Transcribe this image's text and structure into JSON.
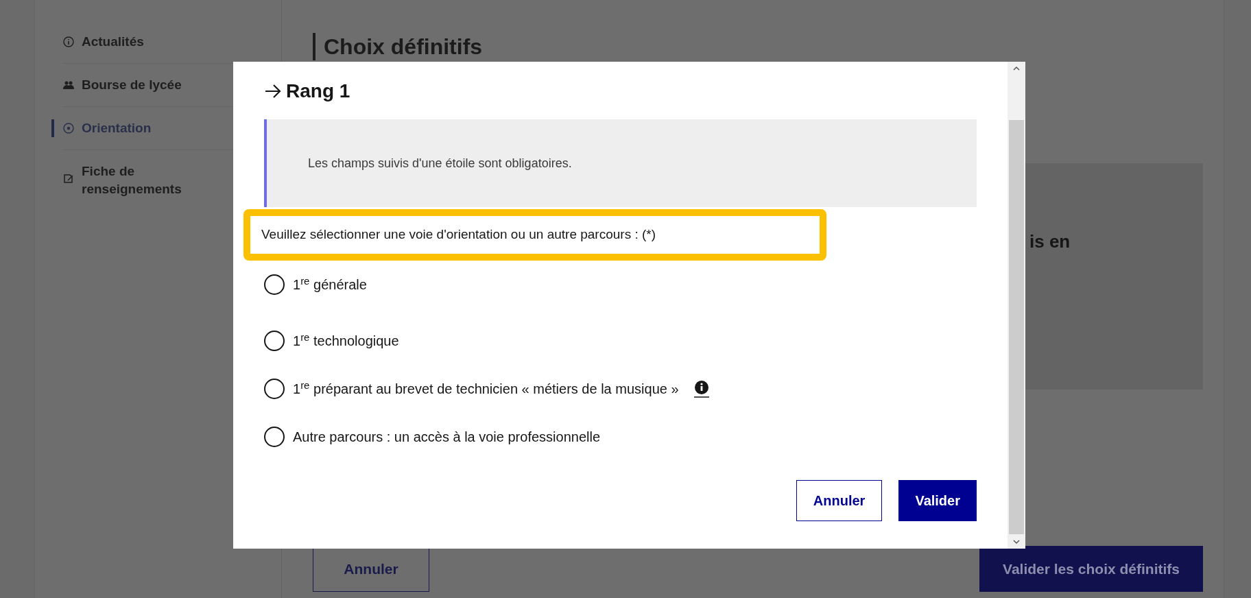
{
  "sidebar": {
    "items": [
      {
        "label": "Actualités",
        "selected": false
      },
      {
        "label": "Bourse de lycée",
        "selected": false
      },
      {
        "label": "Orientation",
        "selected": true
      },
      {
        "label": "Fiche de renseignements",
        "selected": false
      }
    ]
  },
  "page": {
    "title": "Choix définitifs",
    "panel_text": "is en",
    "buttons": [
      {
        "label": "Annuler",
        "kind": "secondary"
      },
      {
        "label": "Valider les choix définitifs",
        "kind": "primary"
      }
    ]
  },
  "dialog": {
    "title": "Rang 1",
    "notice": "Les champs suivis d'une étoile sont obligatoires.",
    "question": "Veuillez sélectionner une voie d'orientation ou un autre parcours : (*)",
    "options": [
      {
        "label": "1$^{re}$ générale",
        "selected": false,
        "info": false
      },
      {
        "label": "1$^{re}$ technologique",
        "selected": false,
        "info": false
      },
      {
        "label": "1$^{re}$ préparant au brevet de technicien « métiers de la musique »",
        "selected": false,
        "info": true
      },
      {
        "label": "Autre parcours : un accès à la voie professionnelle",
        "selected": false,
        "info": false
      }
    ],
    "buttons": [
      {
        "label": "Annuler",
        "kind": "secondary"
      },
      {
        "label": "Valider",
        "kind": "primary"
      }
    ]
  }
}
